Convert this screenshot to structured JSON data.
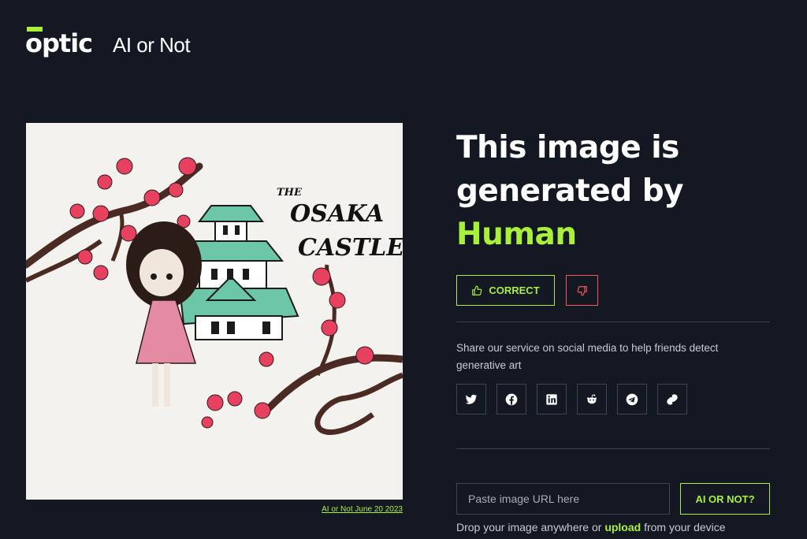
{
  "header": {
    "logo_text": "optic",
    "app_title": "AI or Not"
  },
  "image": {
    "art_title_line1": "THE",
    "art_title_line2": "OSAKA",
    "art_title_line3": "CASTLE",
    "caption": "AI or Not June 20 2023"
  },
  "result": {
    "line1": "This image is",
    "line2": "generated by",
    "verdict": "Human"
  },
  "feedback": {
    "correct_label": "CORRECT",
    "correct_icon": "thumbs-up-icon",
    "wrong_icon": "thumbs-down-icon"
  },
  "share": {
    "text": "Share our service on social media to help friends detect generative art",
    "icons": [
      "twitter-icon",
      "facebook-icon",
      "linkedin-icon",
      "reddit-icon",
      "telegram-icon",
      "link-icon"
    ]
  },
  "check": {
    "placeholder": "Paste image URL here",
    "button_label": "AI OR NOT?",
    "drop_prefix": "Drop your image anywhere or",
    "upload_label": "upload",
    "drop_suffix": "from your device"
  },
  "colors": {
    "background": "#141822",
    "accent": "#a8f03a",
    "danger": "#f15a5a"
  }
}
